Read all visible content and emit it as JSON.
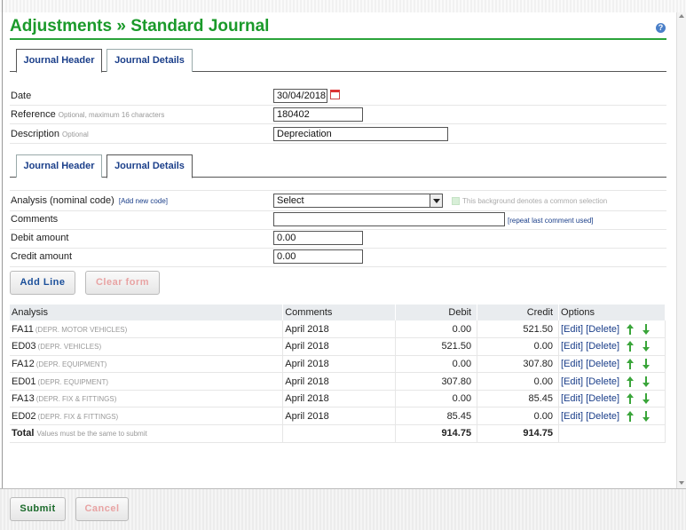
{
  "page": {
    "title": "Adjustments » Standard Journal",
    "help_icon": "?"
  },
  "tabs_top": [
    {
      "label": "Journal Header",
      "active": true
    },
    {
      "label": "Journal Details",
      "active": false
    }
  ],
  "header_form": {
    "date_label": "Date",
    "date_value": "30/04/2018",
    "reference_label": "Reference",
    "reference_hint": "Optional, maximum 16 characters",
    "reference_value": "180402",
    "description_label": "Description",
    "description_hint": "Optional",
    "description_value": "Depreciation"
  },
  "tabs_mid": [
    {
      "label": "Journal Header",
      "active": false
    },
    {
      "label": "Journal Details",
      "active": true
    }
  ],
  "details_form": {
    "analysis_label": "Analysis (nominal code)",
    "add_code_link": "[Add new code]",
    "analysis_selected": "Select",
    "common_note": "This background denotes a common selection",
    "comments_label": "Comments",
    "comments_value": "",
    "repeat_link": "[repeat last comment used]",
    "debit_label": "Debit amount",
    "debit_value": "0.00",
    "credit_label": "Credit amount",
    "credit_value": "0.00"
  },
  "buttons": {
    "add_line": "Add Line",
    "clear_form": "Clear form",
    "submit": "Submit",
    "cancel": "Cancel"
  },
  "table": {
    "headers": [
      "Analysis",
      "Comments",
      "Debit",
      "Credit",
      "Options"
    ],
    "rows": [
      {
        "code": "FA11",
        "desc": "(DEPR. MOTOR VEHICLES)",
        "comment": "April 2018",
        "debit": "0.00",
        "credit": "521.50"
      },
      {
        "code": "ED03",
        "desc": "(DEPR. VEHICLES)",
        "comment": "April 2018",
        "debit": "521.50",
        "credit": "0.00"
      },
      {
        "code": "FA12",
        "desc": "(DEPR. EQUIPMENT)",
        "comment": "April 2018",
        "debit": "0.00",
        "credit": "307.80"
      },
      {
        "code": "ED01",
        "desc": "(DEPR. EQUIPMENT)",
        "comment": "April 2018",
        "debit": "307.80",
        "credit": "0.00"
      },
      {
        "code": "FA13",
        "desc": "(DEPR. FIX & FITTINGS)",
        "comment": "April 2018",
        "debit": "0.00",
        "credit": "85.45"
      },
      {
        "code": "ED02",
        "desc": "(DEPR. FIX & FITTINGS)",
        "comment": "April 2018",
        "debit": "85.45",
        "credit": "0.00"
      }
    ],
    "edit_link": "[Edit]",
    "delete_link": "[Delete]",
    "total_label": "Total",
    "total_hint": "Values must be the same to submit",
    "total_debit": "914.75",
    "total_credit": "914.75"
  },
  "colors": {
    "title_green": "#1a9a2a",
    "link_blue": "#1b3f8a",
    "arrow_green": "#3aa53a"
  }
}
